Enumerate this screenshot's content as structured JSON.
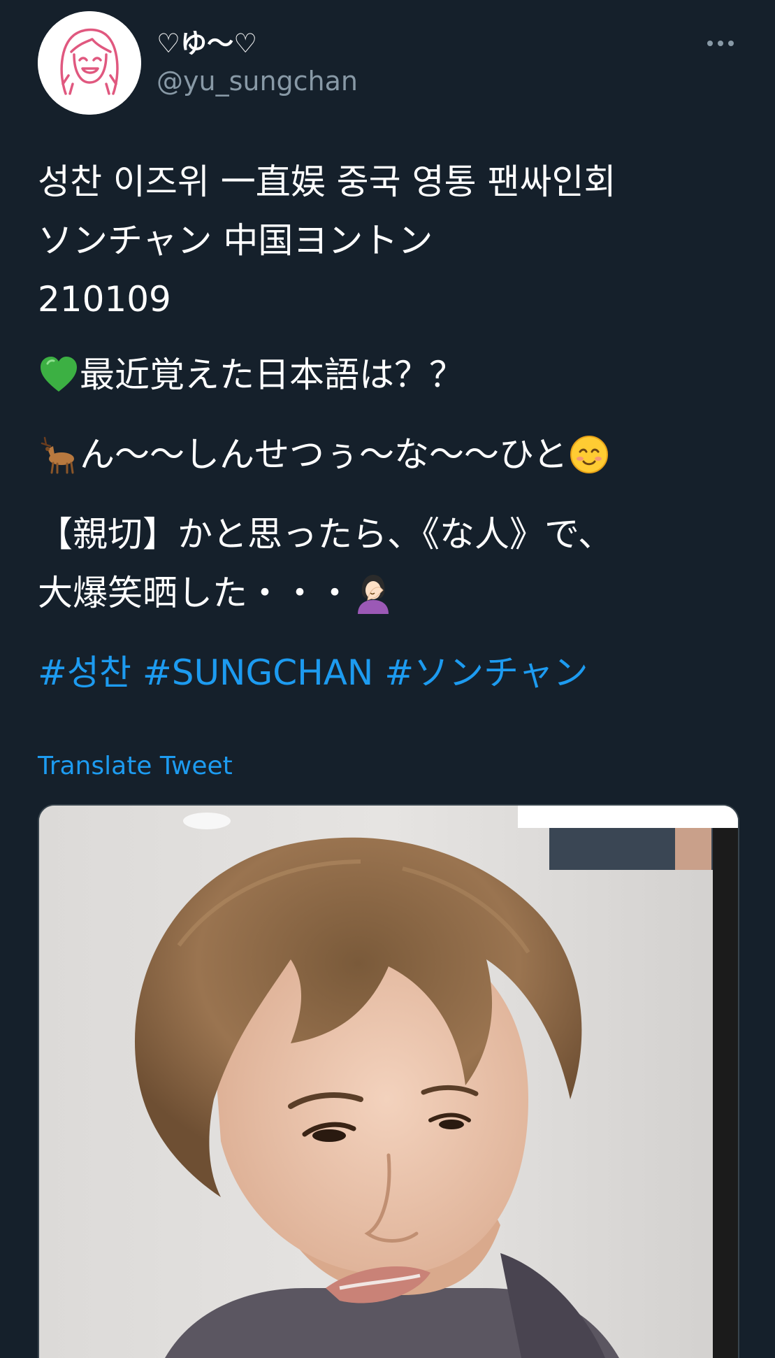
{
  "user": {
    "display_name": "♡ゆ〜♡",
    "handle": "@yu_sungchan"
  },
  "tweet": {
    "lines": [
      "성찬 이즈위 一直娱 중국 영통 팬싸인회",
      "ソンチャン 中国ヨントン",
      "210109"
    ],
    "question": "最近覚えた日本語は？？",
    "answer": "ん〜〜しんせつぅ〜な〜〜ひと",
    "comment_line1": "【親切】かと思ったら、《な人》で、",
    "comment_line2": "大爆笑晒した・・・",
    "hashtags": [
      "#성찬",
      "#SUNGCHAN",
      "#ソンチャン"
    ]
  },
  "translate_label": "Translate Tweet",
  "icons": {
    "question_emoji": "green-heart",
    "answer_emoji_start": "deer",
    "answer_emoji_end": "smiling-face",
    "comment_emoji": "facepalm"
  },
  "colors": {
    "background": "#15202b",
    "link": "#1d9bf0",
    "secondary_text": "#8899a6"
  }
}
